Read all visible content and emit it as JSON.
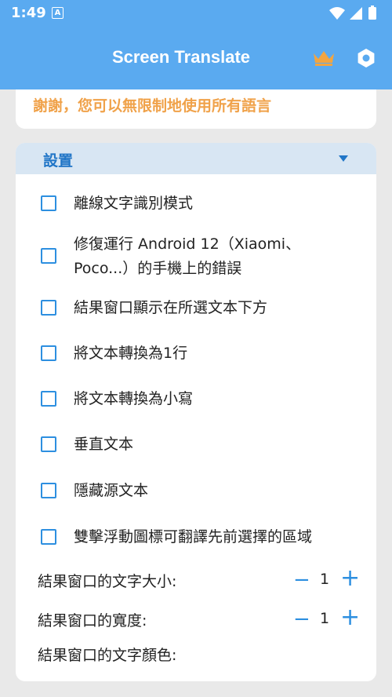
{
  "status": {
    "time": "1:49",
    "badge": "A"
  },
  "app": {
    "title": "Screen Translate"
  },
  "top_card": {
    "message": "謝謝，您可以無限制地使用所有語言"
  },
  "settings": {
    "title": "設置",
    "options": [
      {
        "label": "離線文字識別模式",
        "checked": false
      },
      {
        "label_line1": "修復運行 Android 12（Xiaomi、",
        "label_line2": "Poco...）的手機上的錯誤",
        "checked": false
      },
      {
        "label": "結果窗口顯示在所選文本下方",
        "checked": false
      },
      {
        "label": "將文本轉換為1行",
        "checked": false
      },
      {
        "label": "將文本轉換為小寫",
        "checked": false
      },
      {
        "label": "垂直文本",
        "checked": false
      },
      {
        "label": "隱藏源文本",
        "checked": false
      },
      {
        "label": "雙擊浮動圖標可翻譯先前選擇的區域",
        "checked": false
      }
    ],
    "text_size": {
      "label": "結果窗口的文字大小:",
      "value": "1"
    },
    "window_width": {
      "label": "結果窗口的寬度:",
      "value": "1"
    },
    "text_color": {
      "label": "結果窗口的文字顏色:"
    }
  },
  "colors": {
    "accent": "#5aaaf0",
    "thanks": "#f0a24a",
    "checkbox": "#2d8fe0"
  },
  "icons": {
    "crown": "crown-icon",
    "settings": "gear-icon",
    "wifi": "wifi-icon",
    "signal": "signal-icon",
    "battery": "battery-icon"
  }
}
